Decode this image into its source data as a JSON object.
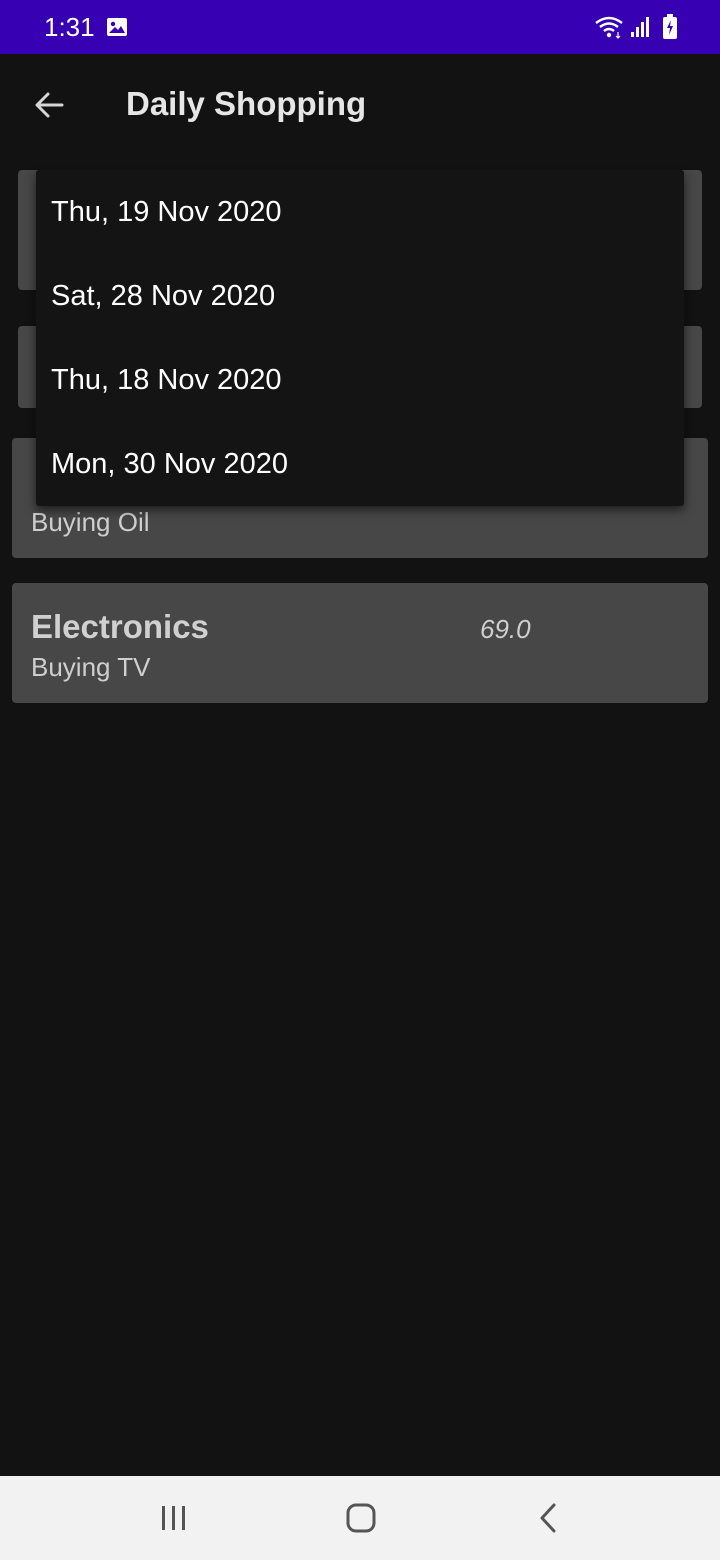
{
  "status_bar": {
    "time": "1:31",
    "icons": [
      "gallery-icon",
      "wifi-icon",
      "signal-icon",
      "battery-icon"
    ],
    "background_color": "#3700b3"
  },
  "app_bar": {
    "title": "Daily Shopping",
    "back_icon": "arrow-back-icon"
  },
  "date_dropdown": {
    "options": [
      "Thu, 19 Nov 2020",
      "Sat, 28 Nov 2020",
      "Thu, 18 Nov 2020",
      "Mon, 30 Nov 2020"
    ]
  },
  "expenses": [
    {
      "category": "",
      "description": "Buying Oil",
      "amount": ""
    },
    {
      "category": "Electronics",
      "description": "Buying TV",
      "amount": "69.0"
    }
  ],
  "nav_bar": {
    "icons": [
      "recent-apps-icon",
      "home-icon",
      "back-icon"
    ]
  },
  "colors": {
    "background": "#121212",
    "card": "#474747",
    "dropdown": "#141414",
    "nav_bar": "#f2f2f2"
  }
}
